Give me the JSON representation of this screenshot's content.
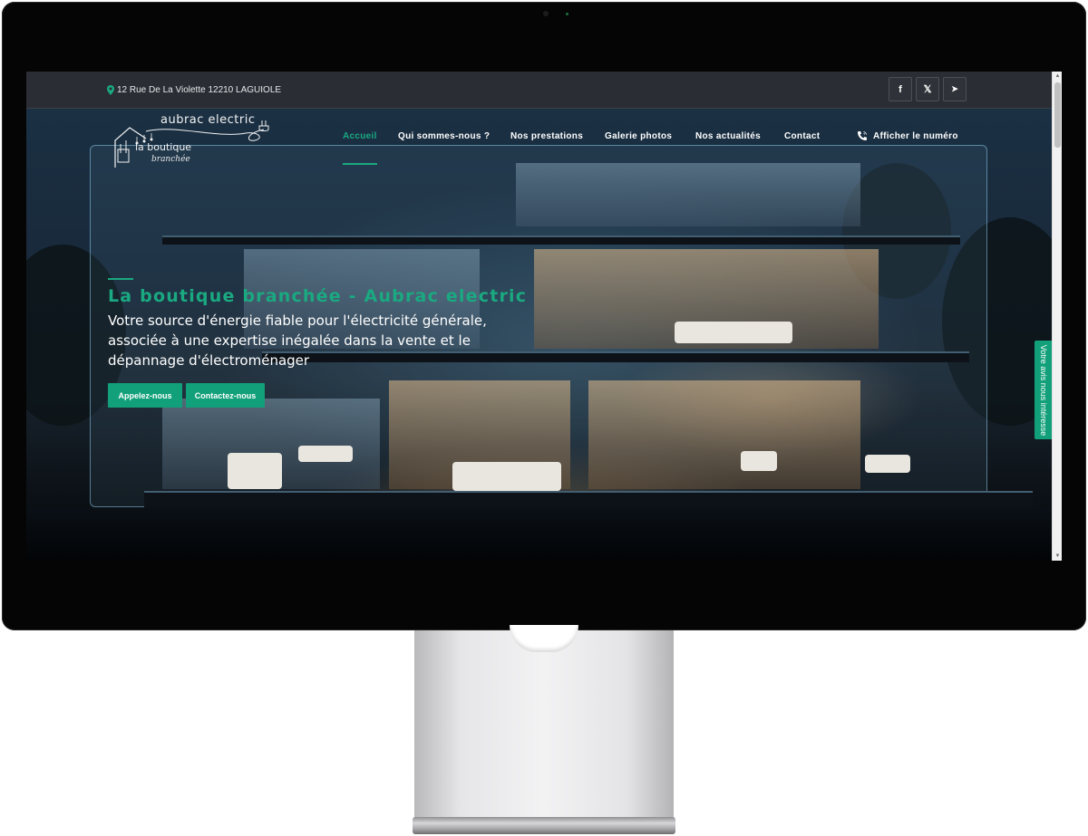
{
  "topbar": {
    "address": "12 Rue De La Violette 12210 LAGUIOLE",
    "social": [
      {
        "icon": "facebook-icon",
        "glyph": "f"
      },
      {
        "icon": "x-twitter-icon",
        "glyph": "𝕏"
      },
      {
        "icon": "telegram-icon",
        "glyph": "➤"
      }
    ]
  },
  "logo": {
    "line1": "aubrac electric",
    "line2": "la boutique",
    "line3": "branchée"
  },
  "nav": {
    "items": [
      {
        "label": "Accueil",
        "active": true
      },
      {
        "label": "Qui sommes-nous ?"
      },
      {
        "label": "Nos prestations"
      },
      {
        "label": "Galerie photos"
      },
      {
        "label": "Nos actualités"
      },
      {
        "label": "Contact"
      }
    ],
    "phone_label": "Afficher le numéro"
  },
  "hero": {
    "title": "La boutique branchée - Aubrac electric",
    "subtitle": "Votre source d'énergie fiable pour l'électricité générale, associée à une expertise inégalée dans la vente et le dépannage d'électroménager",
    "buttons": {
      "call": "Appelez-nous",
      "contact": "Contactez-nous"
    }
  },
  "feedback_tab": "Votre avis nous intéresse",
  "colors": {
    "accent": "#1aa981",
    "topbar": "#2a2d33",
    "button": "#12a07a"
  }
}
